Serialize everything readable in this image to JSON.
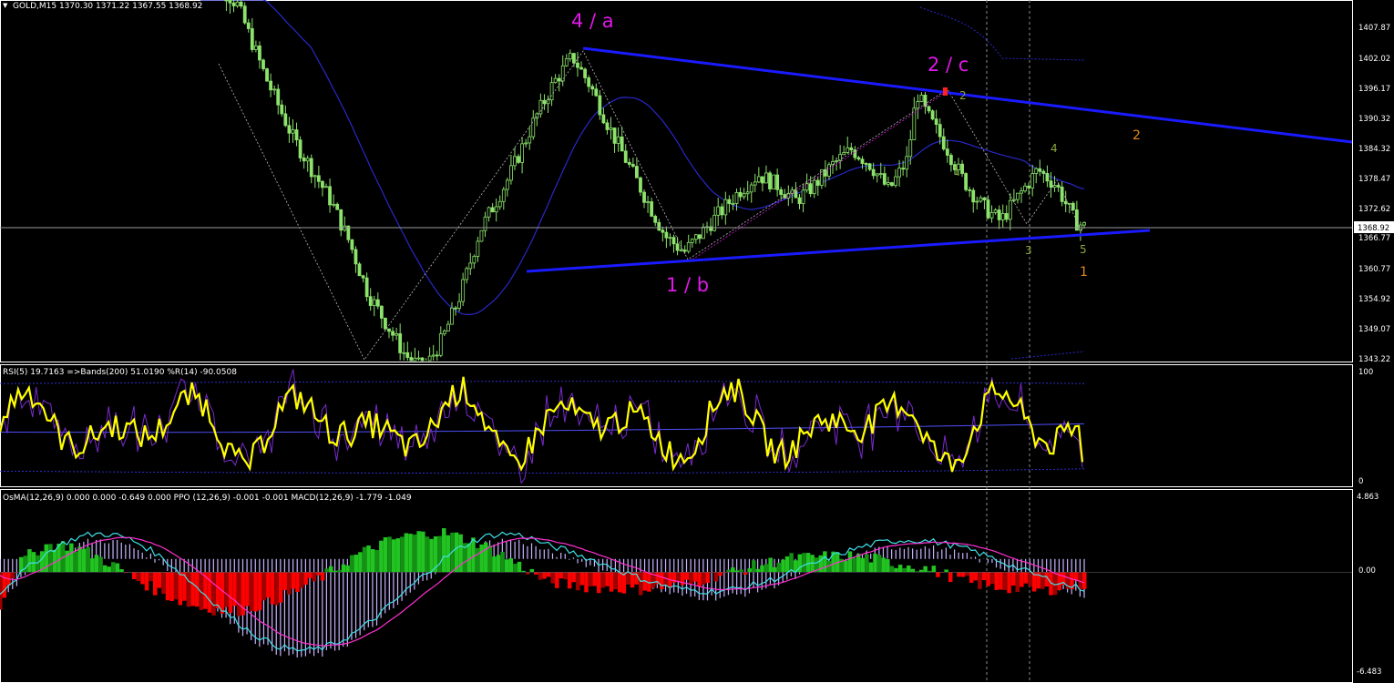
{
  "colors": {
    "background": "#000000",
    "grid": "#ffffff",
    "candle_up": "#8ce26b",
    "candle_down": "#8ce26b",
    "trendline": "#1a1aff",
    "wave_label_major": "#e018e8",
    "wave_label_minor_green": "#8ca83a",
    "wave_label_minor_orange": "#e08a1a",
    "price_line": "#9a9a9a",
    "rsi_main": "#ffff00",
    "rsi_bands": "#3a3aff",
    "wpr": "#7a2ad0",
    "osma_pos": "#22c422",
    "osma_pos_dark": "#149014",
    "osma_neg": "#ff0000",
    "osma_neg_dark": "#a00000",
    "ppo_hist": "#c8b4ff",
    "macd_main": "#40e0e8",
    "macd_signal": "#ff30d0"
  },
  "main_panel": {
    "header": "GOLD,M15  1370.30 1371.22 1367.55 1368.92",
    "price_axis": [
      "1407.87",
      "1402.02",
      "1396.17",
      "1390.32",
      "1384.32",
      "1378.47",
      "1372.62",
      "1366.77",
      "1360.77",
      "1354.92",
      "1349.07",
      "1343.22"
    ],
    "current_price": "1368.92",
    "wave_labels": {
      "major": [
        "4 / a",
        "1 / b",
        "2 / c"
      ],
      "minor_green": [
        "1",
        "2",
        "3",
        "4",
        "5"
      ],
      "minor_orange": [
        "1",
        "2"
      ]
    }
  },
  "rsi_panel": {
    "header": "RSI(5) 19.7163  =>Bands(200) 51.0190  %R(14) -90.0508",
    "scale": [
      "100",
      "0"
    ]
  },
  "macd_panel": {
    "header": "OsMA(12,26,9) 0.000 0.000 -0.649 0.000  PPO (12,26,9) -0.001 -0.001  MACD(12,26,9) -1.779 -1.049",
    "scale": [
      "4.863",
      "0.00",
      "-6.483"
    ]
  },
  "chart_data": [
    {
      "type": "candlestick",
      "title": "GOLD,M15",
      "values": {
        "open": 1370.3,
        "high": 1371.22,
        "low": 1367.55,
        "close": 1368.92
      },
      "ylim": [
        1343.22,
        1413.0
      ],
      "price_path": [
        [
          0,
          1420
        ],
        [
          4,
          1412
        ],
        [
          7,
          1398
        ],
        [
          10,
          1386
        ],
        [
          12,
          1380
        ],
        [
          14,
          1374
        ],
        [
          16,
          1366
        ],
        [
          18,
          1356
        ],
        [
          20,
          1350
        ],
        [
          22,
          1344
        ],
        [
          24,
          1341
        ],
        [
          26,
          1347
        ],
        [
          28,
          1356
        ],
        [
          30,
          1368
        ],
        [
          33,
          1378
        ],
        [
          36,
          1390
        ],
        [
          38,
          1397
        ],
        [
          40,
          1402
        ],
        [
          42,
          1396
        ],
        [
          44,
          1388
        ],
        [
          46,
          1381
        ],
        [
          48,
          1374
        ],
        [
          50,
          1367
        ],
        [
          52,
          1364
        ],
        [
          54,
          1368
        ],
        [
          56,
          1372
        ],
        [
          58,
          1376
        ],
        [
          60,
          1379
        ],
        [
          62,
          1377
        ],
        [
          64,
          1374
        ],
        [
          66,
          1377
        ],
        [
          68,
          1381
        ],
        [
          70,
          1384
        ],
        [
          72,
          1381
        ],
        [
          74,
          1376
        ],
        [
          76,
          1382
        ],
        [
          77,
          1395
        ],
        [
          78,
          1391
        ],
        [
          80,
          1385
        ],
        [
          82,
          1378
        ],
        [
          84,
          1373
        ],
        [
          86,
          1370
        ],
        [
          88,
          1375
        ],
        [
          90,
          1380
        ],
        [
          92,
          1377
        ],
        [
          94,
          1370
        ],
        [
          95,
          1368.9
        ]
      ],
      "trendlines": [
        {
          "name": "upper",
          "from": [
            41,
            1403.6
          ],
          "to": [
            119,
            1385.2
          ]
        },
        {
          "name": "lower",
          "from": [
            46,
            1361.3
          ],
          "to": [
            101,
            1367.8
          ]
        }
      ],
      "wave_points": [
        {
          "label": "4 / a",
          "at": [
            41,
            1403.6
          ]
        },
        {
          "label": "1 / b",
          "at": [
            60,
            1363.9
          ]
        },
        {
          "label": "2 / c",
          "at": [
            81,
            1394.7
          ]
        }
      ]
    },
    {
      "type": "line",
      "title": "RSI(5) 19.7163",
      "ylim": [
        0,
        100
      ],
      "series": [
        {
          "name": "RSI(5)",
          "last": 19.7163
        },
        {
          "name": "Bands(200)",
          "last": 51.019
        },
        {
          "name": "%R(14)",
          "last": -90.0508
        }
      ]
    },
    {
      "type": "bar",
      "title": "OsMA(12,26,9)",
      "ylim": [
        -6.483,
        4.863
      ],
      "series": [
        {
          "name": "OsMA(12,26,9)",
          "last": -0.649
        },
        {
          "name": "PPO (12,26,9)",
          "last": -0.001
        },
        {
          "name": "MACD(12,26,9)",
          "last": -1.779,
          "signal": -1.049
        }
      ]
    }
  ]
}
